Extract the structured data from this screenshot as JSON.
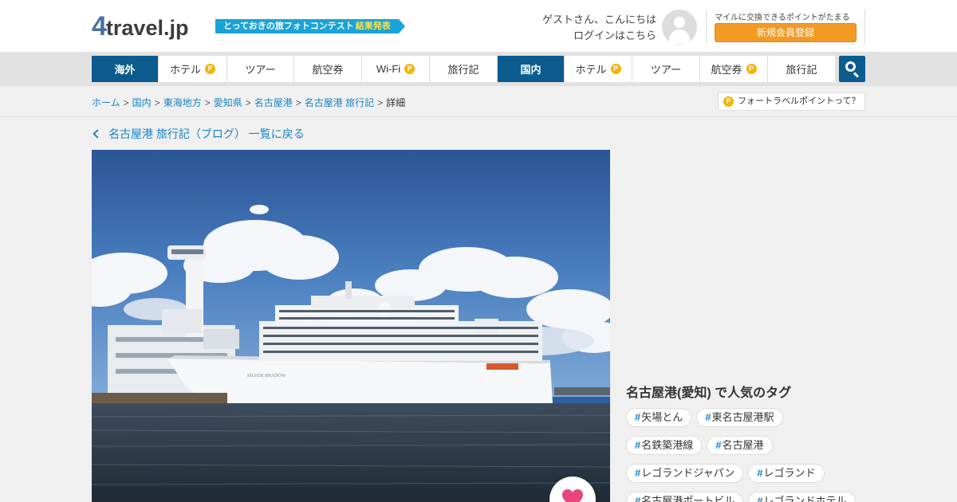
{
  "header": {
    "logo_prefix": "4",
    "logo_text": "travel.jp",
    "banner_text": "とっておきの旅フォトコンテスト",
    "banner_highlight": "結果発表",
    "greeting": "ゲストさん、こんにちは",
    "login": "ログインはこちら",
    "mile_text": "マイルに交換できるポイントがたまる",
    "register_label": "新規会員登録"
  },
  "nav": {
    "items": [
      {
        "label": "海外",
        "active": true,
        "points": false
      },
      {
        "label": "ホテル",
        "active": false,
        "points": true
      },
      {
        "label": "ツアー",
        "active": false,
        "points": false
      },
      {
        "label": "航空券",
        "active": false,
        "points": false
      },
      {
        "label": "Wi-Fi",
        "active": false,
        "points": true
      },
      {
        "label": "旅行記",
        "active": false,
        "points": false
      },
      {
        "label": "国内",
        "active": true,
        "points": false
      },
      {
        "label": "ホテル",
        "active": false,
        "points": true
      },
      {
        "label": "ツアー",
        "active": false,
        "points": false
      },
      {
        "label": "航空券",
        "active": false,
        "points": true
      },
      {
        "label": "旅行記",
        "active": false,
        "points": false
      }
    ],
    "points_badge": "P"
  },
  "breadcrumb": {
    "items": [
      "ホーム",
      "国内",
      "東海地方",
      "愛知県",
      "名古屋港",
      "名古屋港 旅行記"
    ],
    "separator": ">",
    "current": "詳細"
  },
  "points_link": "フォートラベルポイントって？",
  "back_link": "名古屋港 旅行記（ブログ） 一覧に戻る",
  "photo": {
    "ship_name": "SILVER SHADOW"
  },
  "tags": {
    "title": "名古屋港(愛知) で人気のタグ",
    "hash": "#",
    "rows": [
      [
        "矢場とん",
        "東名古屋港駅"
      ],
      [
        "名鉄築港線",
        "名古屋港"
      ],
      [
        "レゴランドジャパン",
        "レゴランド"
      ],
      [
        "名古屋港ポートビル",
        "レゴランドホテル"
      ]
    ]
  },
  "colors": {
    "brand_blue": "#0b5b8f",
    "link_blue": "#1a83c6",
    "register_orange": "#f39a24",
    "points_yellow": "#f4b400",
    "like_pink": "#e8457a"
  }
}
